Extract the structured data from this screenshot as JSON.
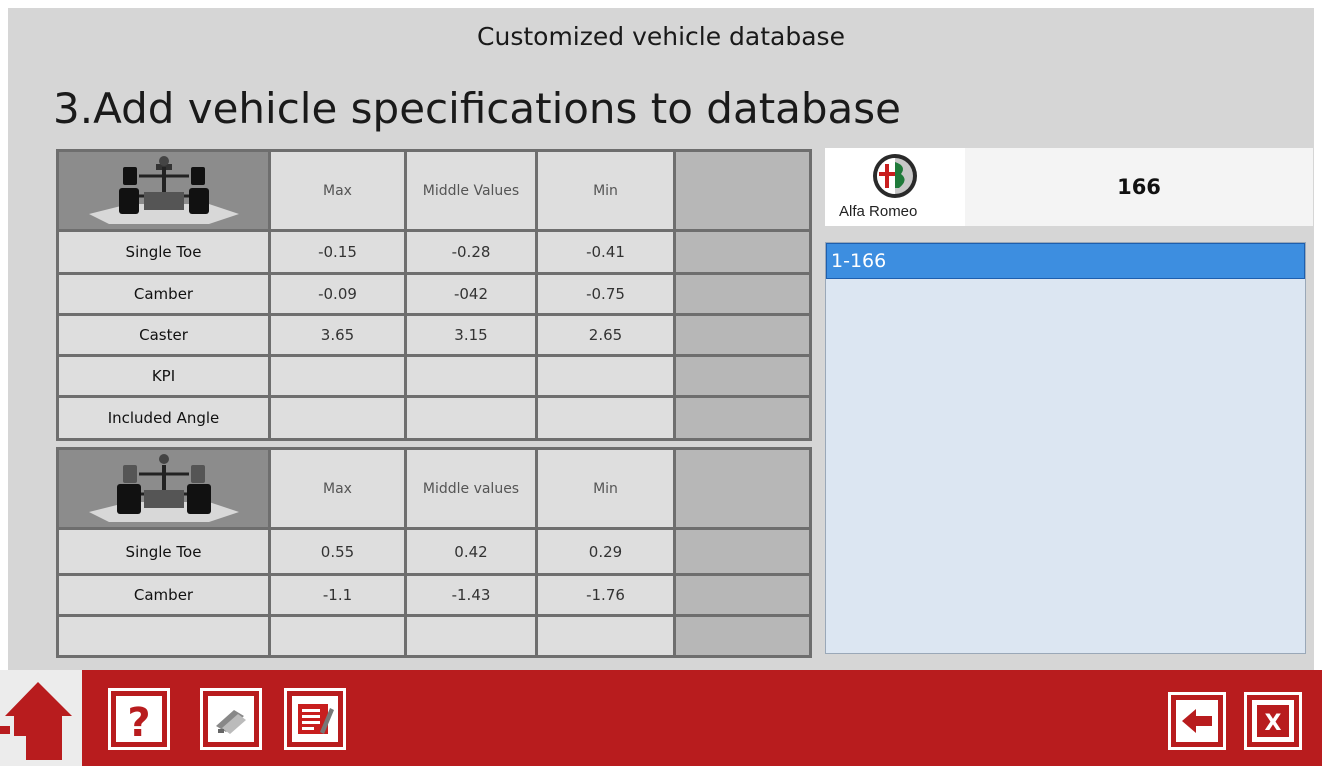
{
  "header": {
    "title": "Customized vehicle database"
  },
  "page": {
    "heading": "3.Add vehicle specifications to database"
  },
  "front_axle": {
    "columns": [
      "Max",
      "Middle Values",
      "Min"
    ],
    "rows": [
      {
        "label": "Single Toe",
        "max": "-0.15",
        "mid": "-0.28",
        "min": "-0.41"
      },
      {
        "label": "Camber",
        "max": "-0.09",
        "mid": "-042",
        "min": "-0.75"
      },
      {
        "label": "Caster",
        "max": "3.65",
        "mid": "3.15",
        "min": "2.65"
      },
      {
        "label": "KPI",
        "max": "",
        "mid": "",
        "min": ""
      },
      {
        "label": "Included Angle",
        "max": "",
        "mid": "",
        "min": ""
      }
    ]
  },
  "rear_axle": {
    "columns": [
      "Max",
      "Middle values",
      "Min"
    ],
    "rows": [
      {
        "label": "Single Toe",
        "max": "0.55",
        "mid": "0.42",
        "min": "0.29"
      },
      {
        "label": "Camber",
        "max": "-1.1",
        "mid": "-1.43",
        "min": "-1.76"
      },
      {
        "label": "",
        "max": "",
        "mid": "",
        "min": ""
      }
    ]
  },
  "brand": {
    "name": "Alfa Romeo",
    "model": "166",
    "logo_icon": "alfa-romeo-logo"
  },
  "model_list": {
    "items": [
      {
        "label": "1-166",
        "selected": true
      }
    ]
  },
  "toolbar": {
    "accent_color": "#b81c1e",
    "left_buttons": [
      "home-icon",
      "help-icon",
      "tools-icon",
      "edit-list-icon"
    ],
    "right_buttons": [
      "back-icon",
      "close-icon"
    ],
    "close_label": "X"
  }
}
